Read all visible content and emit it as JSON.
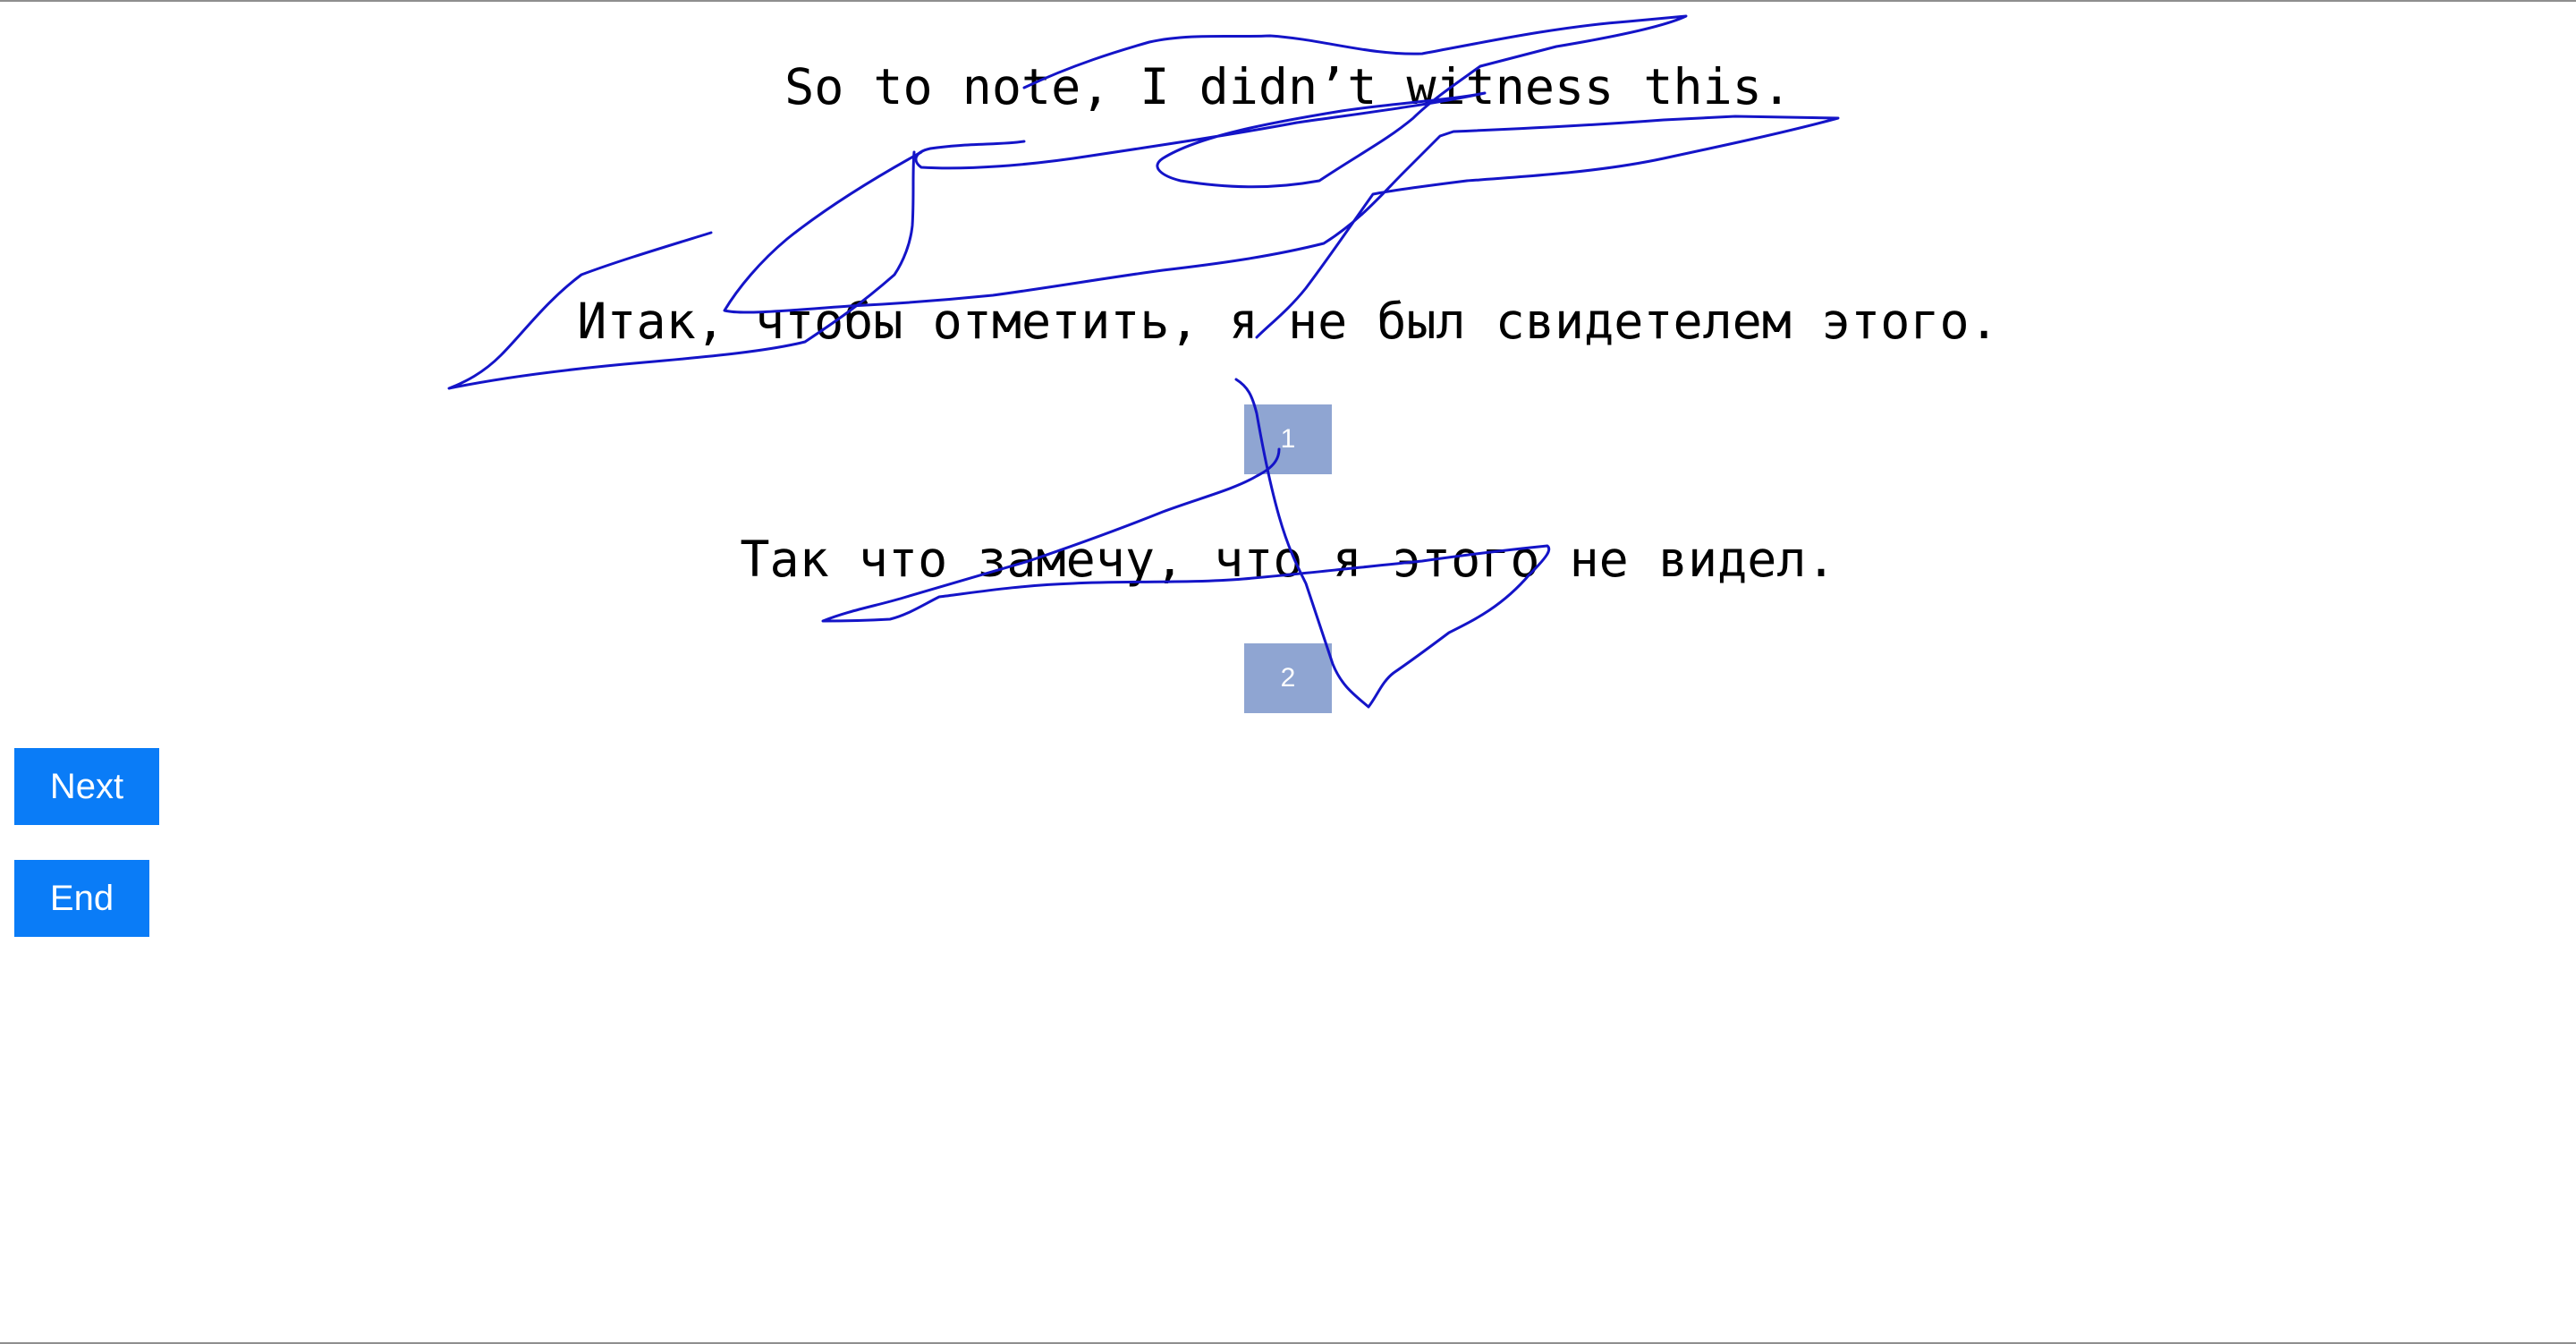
{
  "sentences": {
    "source": "So to note, I didn’t witness this.",
    "reference": "Итак, чтобы отметить, я не был свидетелем этого.",
    "candidate": "Так что замечу, что я этого не видел."
  },
  "rank_boxes": [
    {
      "label": "1"
    },
    {
      "label": "2"
    }
  ],
  "buttons": {
    "next_label": "Next",
    "end_label": "End"
  },
  "colors": {
    "button_blue": "#0a7cf7",
    "rank_box": "#8fa5d2",
    "ink_stroke": "#1414c8"
  }
}
